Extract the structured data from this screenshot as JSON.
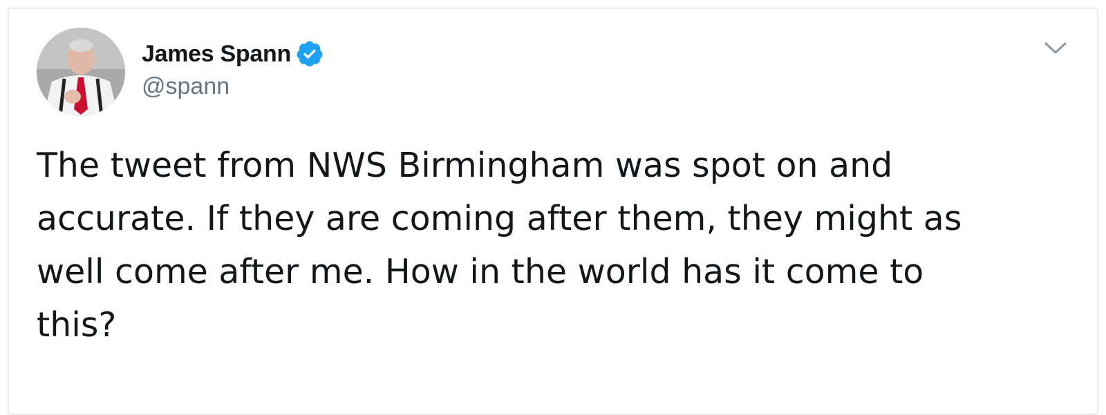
{
  "tweet": {
    "author": {
      "display_name": "James Spann",
      "handle": "@spann",
      "verified": true,
      "verified_icon": "verified-badge-icon",
      "verified_color": "#1da1f2"
    },
    "menu_icon": "chevron-down-icon",
    "text": "The tweet from NWS Birmingham was spot on and\naccurate. If they are coming after them, they might as\nwell come after me. How in the world has it come to\nthis?"
  }
}
